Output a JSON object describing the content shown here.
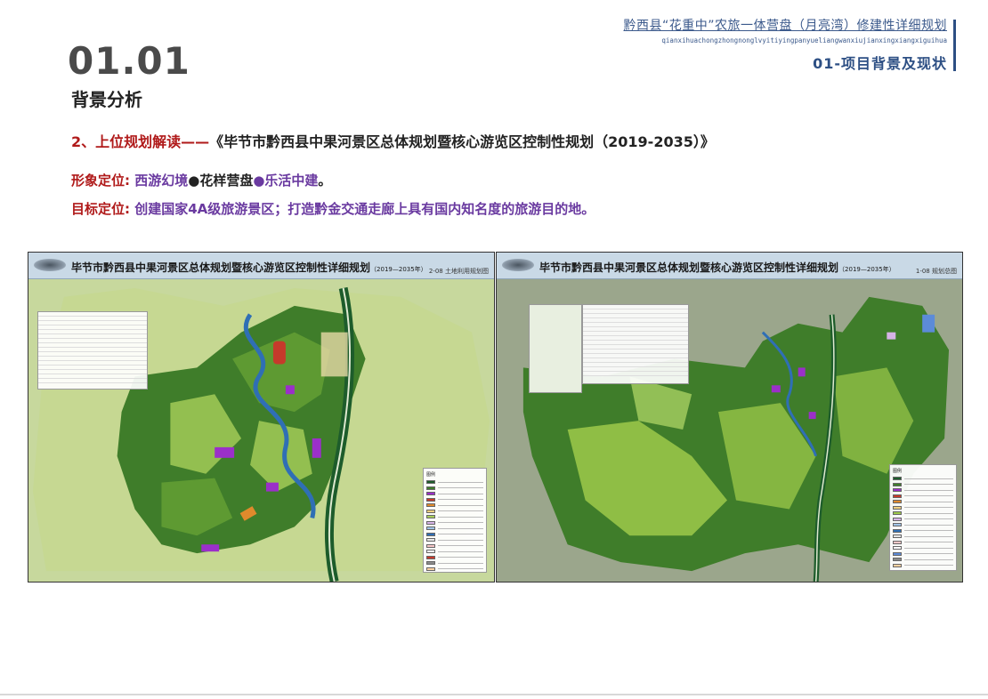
{
  "header": {
    "title": "黔西县“花重中”农旅一体营盘（月亮湾）修建性详细规划",
    "pinyin": "qianxihuachongzhongnonglvyitiyingpanyueliangwanxiujianxingxiangxiguihua",
    "section": "01-项目背景及现状"
  },
  "page": {
    "number": "01.01",
    "subtitle": "背景分析"
  },
  "plan": {
    "lead": "2、上位规划解读——",
    "book": "《毕节市黔西县中果河景区总体规划暨核心游览区控制性规划（2019-2035）》"
  },
  "positioning": {
    "image_label": "形象定位:",
    "image_part1": " 西游幻境",
    "image_part2": "●花样营盘",
    "image_part3": "●乐活中建",
    "image_end": "。",
    "goal_label": "目标定位:",
    "goal_part1": " 创建国家4A级旅游景区；",
    "goal_part2": "打造黔金交通走廊上具有国内知名度的旅游目的地。"
  },
  "maps": [
    {
      "title_a": "毕节市黔西县",
      "title_b": "中果河景区",
      "title_c": "总体规划暨核心游览区控制性详细规划",
      "years": "（2019—2035年）",
      "code": "2-08  土地利用规划图",
      "legend_title": "图例"
    },
    {
      "title_a": "毕节市黔西县",
      "title_b": "中果河景区",
      "title_c": "总体规划暨核心游览区控制性详细规划",
      "years": "（2019—2035年）",
      "code": "1-08  规划总图",
      "legend_title": "图例"
    }
  ],
  "colors": {
    "accent_red": "#b01a1a",
    "accent_purple": "#6a3aa0",
    "header_blue": "#2d4f84",
    "forest_green": "#3f7d2a",
    "light_green": "#a9cf5a",
    "river_blue": "#2f6fb5",
    "highlight_purple": "#9b2fc9",
    "highlight_orange": "#e08a2c"
  }
}
